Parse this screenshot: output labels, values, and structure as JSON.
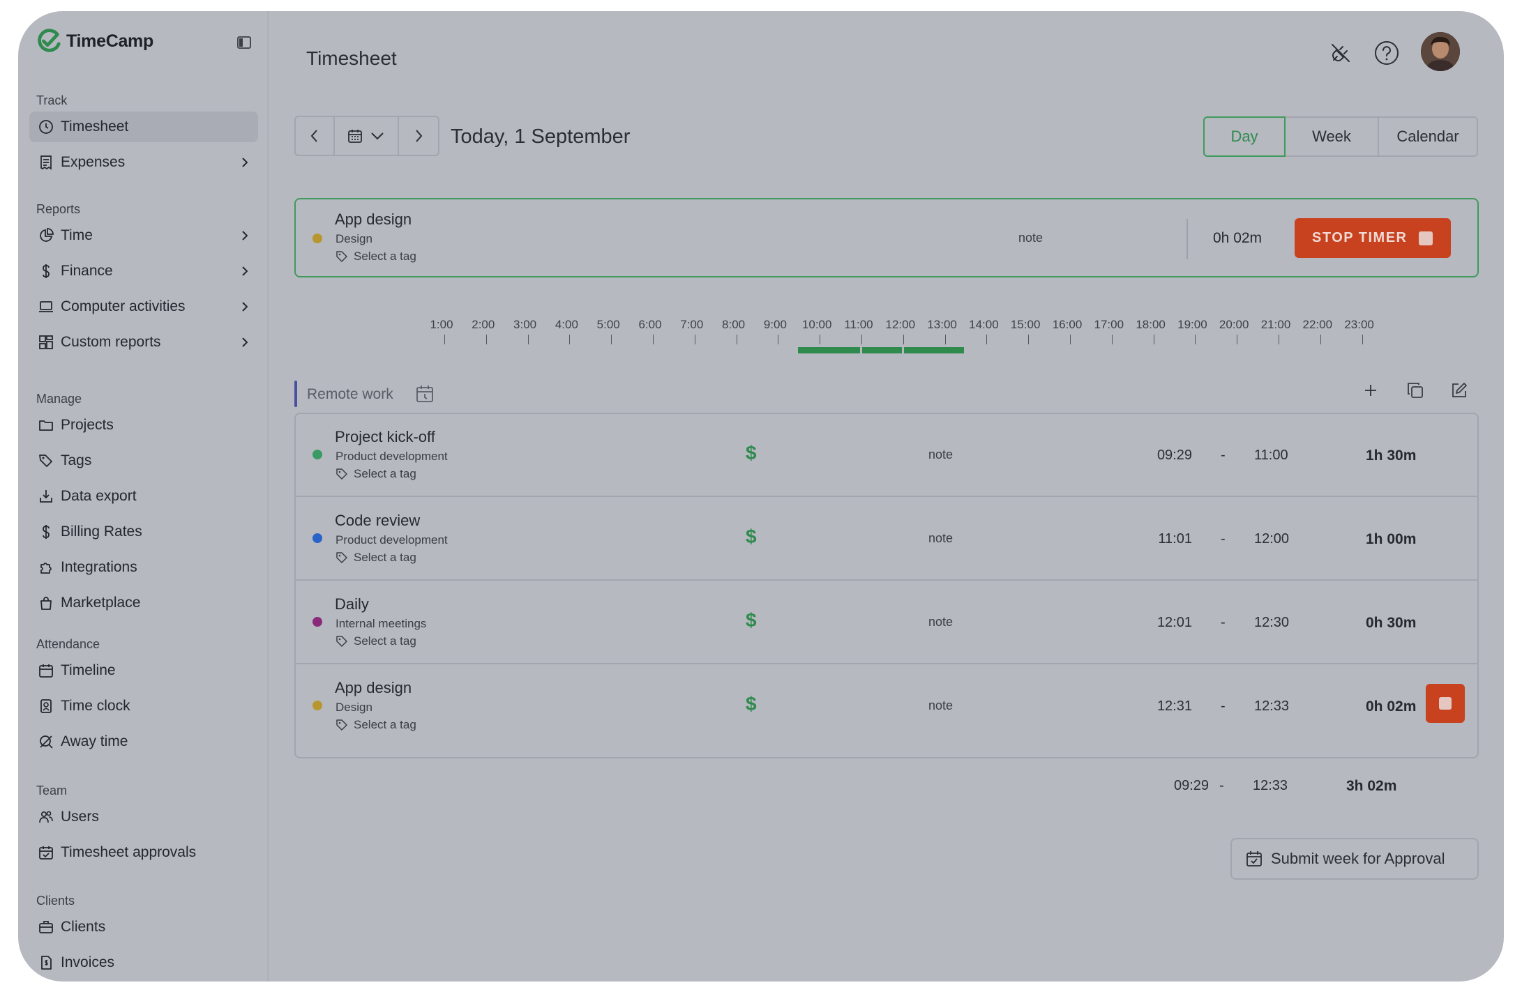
{
  "app": {
    "brand": "TimeCamp",
    "brand_color": "#2f8a4e",
    "danger_color": "#c8421f"
  },
  "sidebar": {
    "sections": [
      {
        "title": "Track",
        "items": [
          {
            "label": "Timesheet",
            "icon": "clock-icon",
            "active": true,
            "chevron": false
          },
          {
            "label": "Expenses",
            "icon": "receipt-icon",
            "chevron": true
          }
        ]
      },
      {
        "title": "Reports",
        "items": [
          {
            "label": "Time",
            "icon": "pie-chart-icon",
            "chevron": true
          },
          {
            "label": "Finance",
            "icon": "dollar-icon",
            "chevron": true
          },
          {
            "label": "Computer activities",
            "icon": "laptop-icon",
            "chevron": true
          },
          {
            "label": "Custom reports",
            "icon": "dashboard-icon",
            "chevron": true
          }
        ]
      },
      {
        "title": "Manage",
        "items": [
          {
            "label": "Projects",
            "icon": "folder-icon"
          },
          {
            "label": "Tags",
            "icon": "tag-icon"
          },
          {
            "label": "Data export",
            "icon": "download-icon"
          },
          {
            "label": "Billing Rates",
            "icon": "dollar-icon"
          },
          {
            "label": "Integrations",
            "icon": "puzzle-icon"
          },
          {
            "label": "Marketplace",
            "icon": "shopping-bag-icon"
          }
        ]
      },
      {
        "title": "Attendance",
        "items": [
          {
            "label": "Timeline",
            "icon": "calendar-icon"
          },
          {
            "label": "Time clock",
            "icon": "badge-icon"
          },
          {
            "label": "Away time",
            "icon": "away-icon"
          }
        ]
      },
      {
        "title": "Team",
        "items": [
          {
            "label": "Users",
            "icon": "users-icon"
          },
          {
            "label": "Timesheet approvals",
            "icon": "calendar-check-icon"
          }
        ]
      },
      {
        "title": "Clients",
        "items": [
          {
            "label": "Clients",
            "icon": "briefcase-icon"
          },
          {
            "label": "Invoices",
            "icon": "invoice-icon"
          }
        ]
      }
    ]
  },
  "header": {
    "title": "Timesheet"
  },
  "date_nav": {
    "label": "Today, 1 September"
  },
  "view_toggle": {
    "options": [
      "Day",
      "Week",
      "Calendar"
    ],
    "selected": "Day"
  },
  "running_timer": {
    "title": "App design",
    "project": "Design",
    "dot_color": "#b8962f",
    "tag_placeholder": "Select a tag",
    "note": "note",
    "duration": "0h 02m",
    "stop_label": "STOP TIMER"
  },
  "timeline": {
    "hours": [
      "1:00",
      "2:00",
      "3:00",
      "4:00",
      "5:00",
      "6:00",
      "7:00",
      "8:00",
      "9:00",
      "10:00",
      "11:00",
      "12:00",
      "13:00",
      "14:00",
      "15:00",
      "16:00",
      "17:00",
      "18:00",
      "19:00",
      "20:00",
      "21:00",
      "22:00",
      "23:00"
    ],
    "segments": [
      {
        "start": "09:29",
        "end": "11:00"
      },
      {
        "start": "11:01",
        "end": "12:00"
      },
      {
        "start": "12:01",
        "end": "13:30"
      }
    ]
  },
  "group": {
    "label": "Remote work"
  },
  "entries": [
    {
      "title": "Project kick-off",
      "project": "Product development",
      "dot_color": "#3a9a64",
      "tag": "Select a tag",
      "note": "note",
      "start": "09:29",
      "sep": "-",
      "end": "11:00",
      "duration": "1h 30m",
      "running": false
    },
    {
      "title": "Code review",
      "project": "Product development",
      "dot_color": "#2a63c8",
      "tag": "Select a tag",
      "note": "note",
      "start": "11:01",
      "sep": "-",
      "end": "12:00",
      "duration": "1h 00m",
      "running": false
    },
    {
      "title": "Daily",
      "project": "Internal meetings",
      "dot_color": "#8a2a7a",
      "tag": "Select a tag",
      "note": "note",
      "start": "12:01",
      "sep": "-",
      "end": "12:30",
      "duration": "0h 30m",
      "running": false
    },
    {
      "title": "App design",
      "project": "Design",
      "dot_color": "#b8962f",
      "tag": "Select a tag",
      "note": "note",
      "start": "12:31",
      "sep": "-",
      "end": "12:33",
      "duration": "0h 02m",
      "running": true
    }
  ],
  "totals": {
    "start": "09:29",
    "sep": "-",
    "end": "12:33",
    "duration": "3h 02m"
  },
  "submit": {
    "label": "Submit week for Approval"
  }
}
